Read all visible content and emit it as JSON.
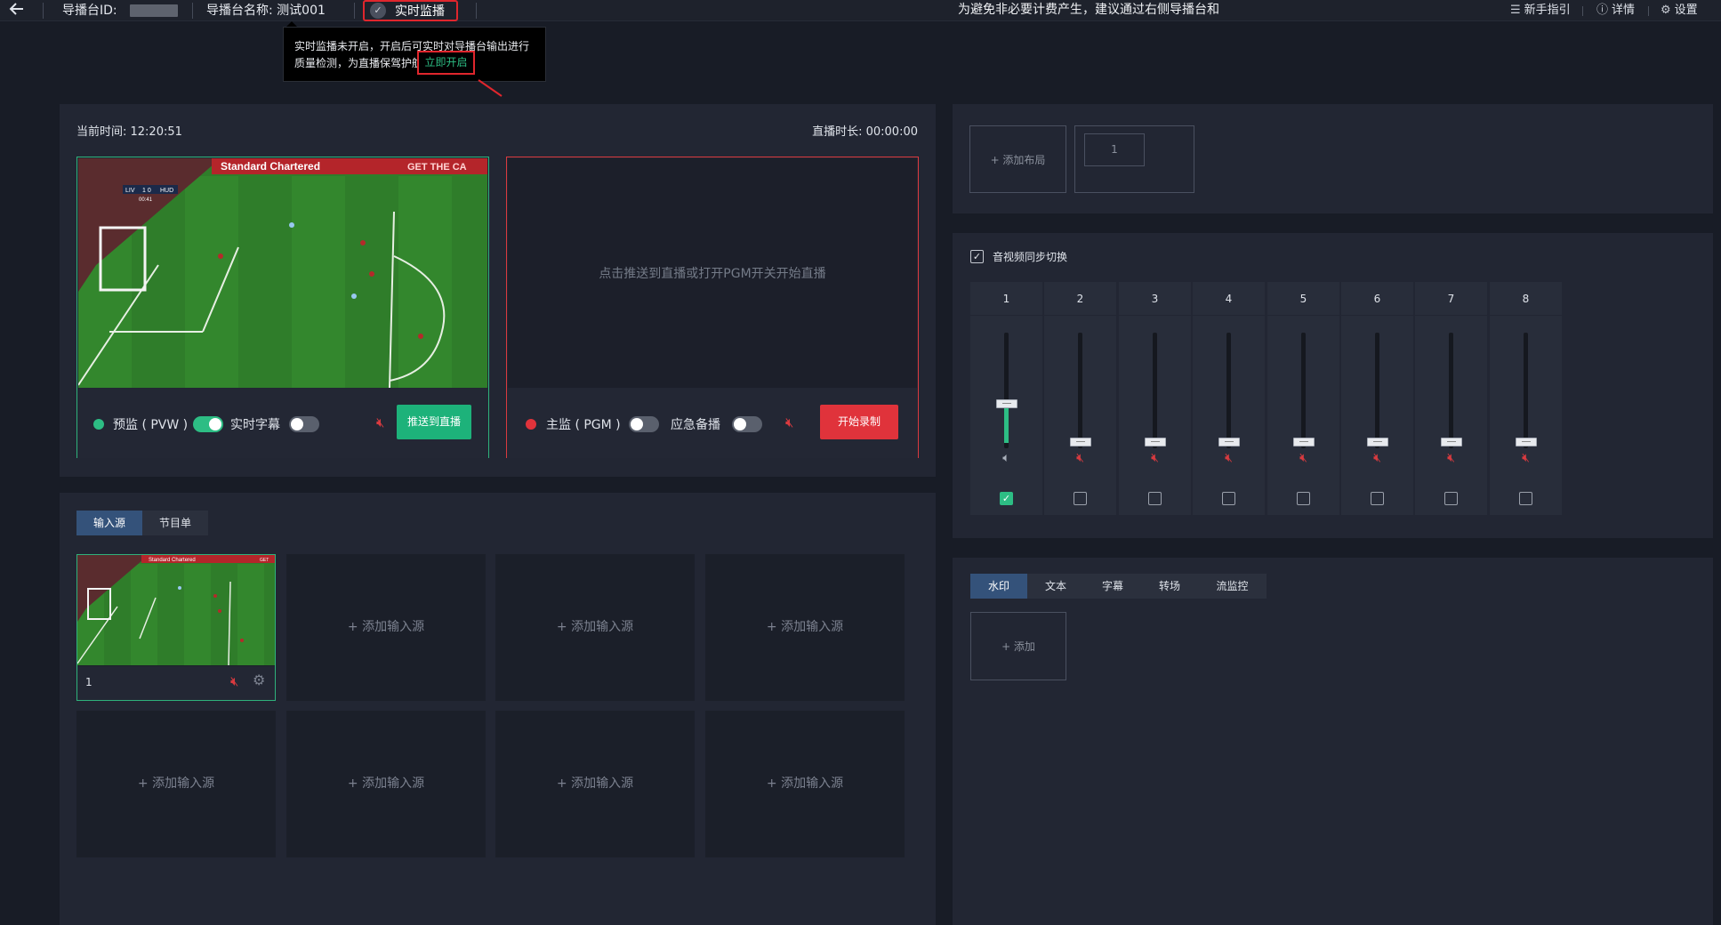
{
  "topbar": {
    "back_icon": "arrow-left-icon",
    "id_label": "导播台ID:",
    "name_label": "导播台名称: 测试001",
    "monitor_label": "实时监播",
    "notice": "为避免非必要计费产生，建议通过右侧导播台和",
    "guide_label": "新手指引",
    "details_label": "详情",
    "settings_label": "设置"
  },
  "tooltip": {
    "line1": "实时监播未开启，开启后可实时对导播台输出进行",
    "line2": "质量检测，为直播保驾护航",
    "action": "立即开启"
  },
  "preview": {
    "current_time_label": "当前时间: 12:20:51",
    "duration_label": "直播时长: 00:00:00",
    "pvw_label": "预监 ( PVW )",
    "subtitle_label": "实时字幕",
    "push_button": "推送到直播",
    "pgm_label": "主监 ( PGM )",
    "backup_label": "应急备播",
    "record_button": "开始录制",
    "pgm_placeholder": "点击推送到直播或打开PGM开关开始直播",
    "pvw_toggle_on": true,
    "subtitle_toggle_on": false,
    "pgm_toggle_on": false,
    "backup_toggle_on": false,
    "scene_ad_text": "Standard Chartered",
    "scene_ad_text2": "GET THE CA",
    "score_home": "LIV",
    "score_value": "1 0",
    "score_away": "HUD",
    "score_time": "00:41"
  },
  "sources": {
    "tabs": [
      "输入源",
      "节目单"
    ],
    "active_tab": 0,
    "add_label": "+ 添加输入源",
    "source1_number": "1",
    "source1_ad": "Standard Chartered",
    "source1_ad2": "GET"
  },
  "layout": {
    "add_label": "+ 添加布局",
    "layout1": "1"
  },
  "audio": {
    "sync_label": "音视频同步切换",
    "sync_checked": true,
    "channels": [
      {
        "num": "1",
        "level": 0.38,
        "muted": false,
        "selected": true
      },
      {
        "num": "2",
        "level": 0,
        "muted": true,
        "selected": false
      },
      {
        "num": "3",
        "level": 0,
        "muted": true,
        "selected": false
      },
      {
        "num": "4",
        "level": 0,
        "muted": true,
        "selected": false
      },
      {
        "num": "5",
        "level": 0,
        "muted": true,
        "selected": false
      },
      {
        "num": "6",
        "level": 0,
        "muted": true,
        "selected": false
      },
      {
        "num": "7",
        "level": 0,
        "muted": true,
        "selected": false
      },
      {
        "num": "8",
        "level": 0,
        "muted": true,
        "selected": false
      }
    ]
  },
  "effects": {
    "tabs": [
      "水印",
      "文本",
      "字幕",
      "转场",
      "流监控"
    ],
    "active_tab": 0,
    "add_label": "+ 添加"
  },
  "colors": {
    "accent_green": "#2dbd84",
    "accent_red": "#e0333b",
    "tab_active": "#34527a"
  }
}
